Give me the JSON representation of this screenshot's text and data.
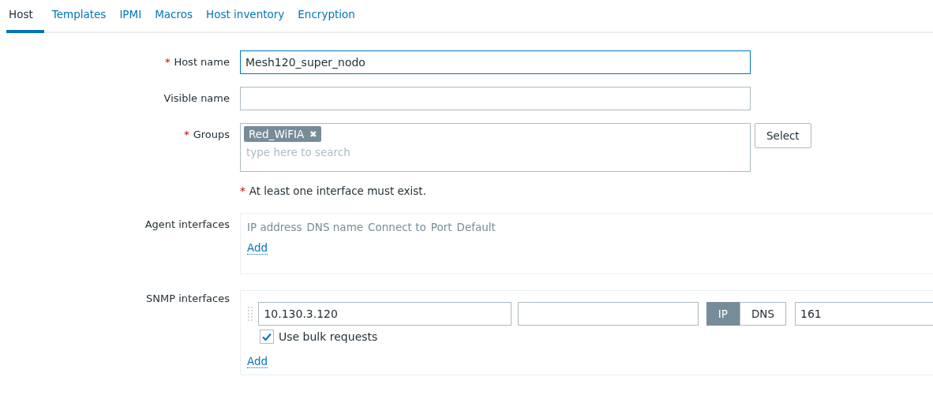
{
  "tabs": [
    {
      "label": "Host",
      "selected": true
    },
    {
      "label": "Templates",
      "selected": false
    },
    {
      "label": "IPMI",
      "selected": false
    },
    {
      "label": "Macros",
      "selected": false
    },
    {
      "label": "Host inventory",
      "selected": false
    },
    {
      "label": "Encryption",
      "selected": false
    }
  ],
  "host_name": {
    "mark": "*",
    "label": "Host name",
    "value": "Mesh120_super_nodo",
    "focused": true
  },
  "visible_name": {
    "label": "Visible name",
    "focused": false
  },
  "groups": {
    "mark": "*",
    "label": "Groups",
    "tags": [
      {
        "label": "Red_WiFIA",
        "remove": "✖"
      }
    ],
    "placeholder": "type here to search",
    "select_button": "Select"
  },
  "message": {
    "mark": "*",
    "text": "At least one interface must exist."
  },
  "agent_interfaces": {
    "label": "Agent interfaces",
    "columns": [
      "IP address",
      "DNS name",
      "Connect to",
      "Port",
      "Default"
    ],
    "add_link": "Add"
  },
  "snmp_interfaces": {
    "label": "SNMP interfaces",
    "rows": [
      {
        "ip": "10.130.3.120",
        "connect_to": [
          {
            "label": "IP",
            "selected": true
          },
          {
            "label": "DNS",
            "selected": false
          }
        ],
        "port": "161",
        "bulk": {
          "label": "Use bulk requests",
          "checked": true
        }
      }
    ],
    "add_link": "Add"
  }
}
